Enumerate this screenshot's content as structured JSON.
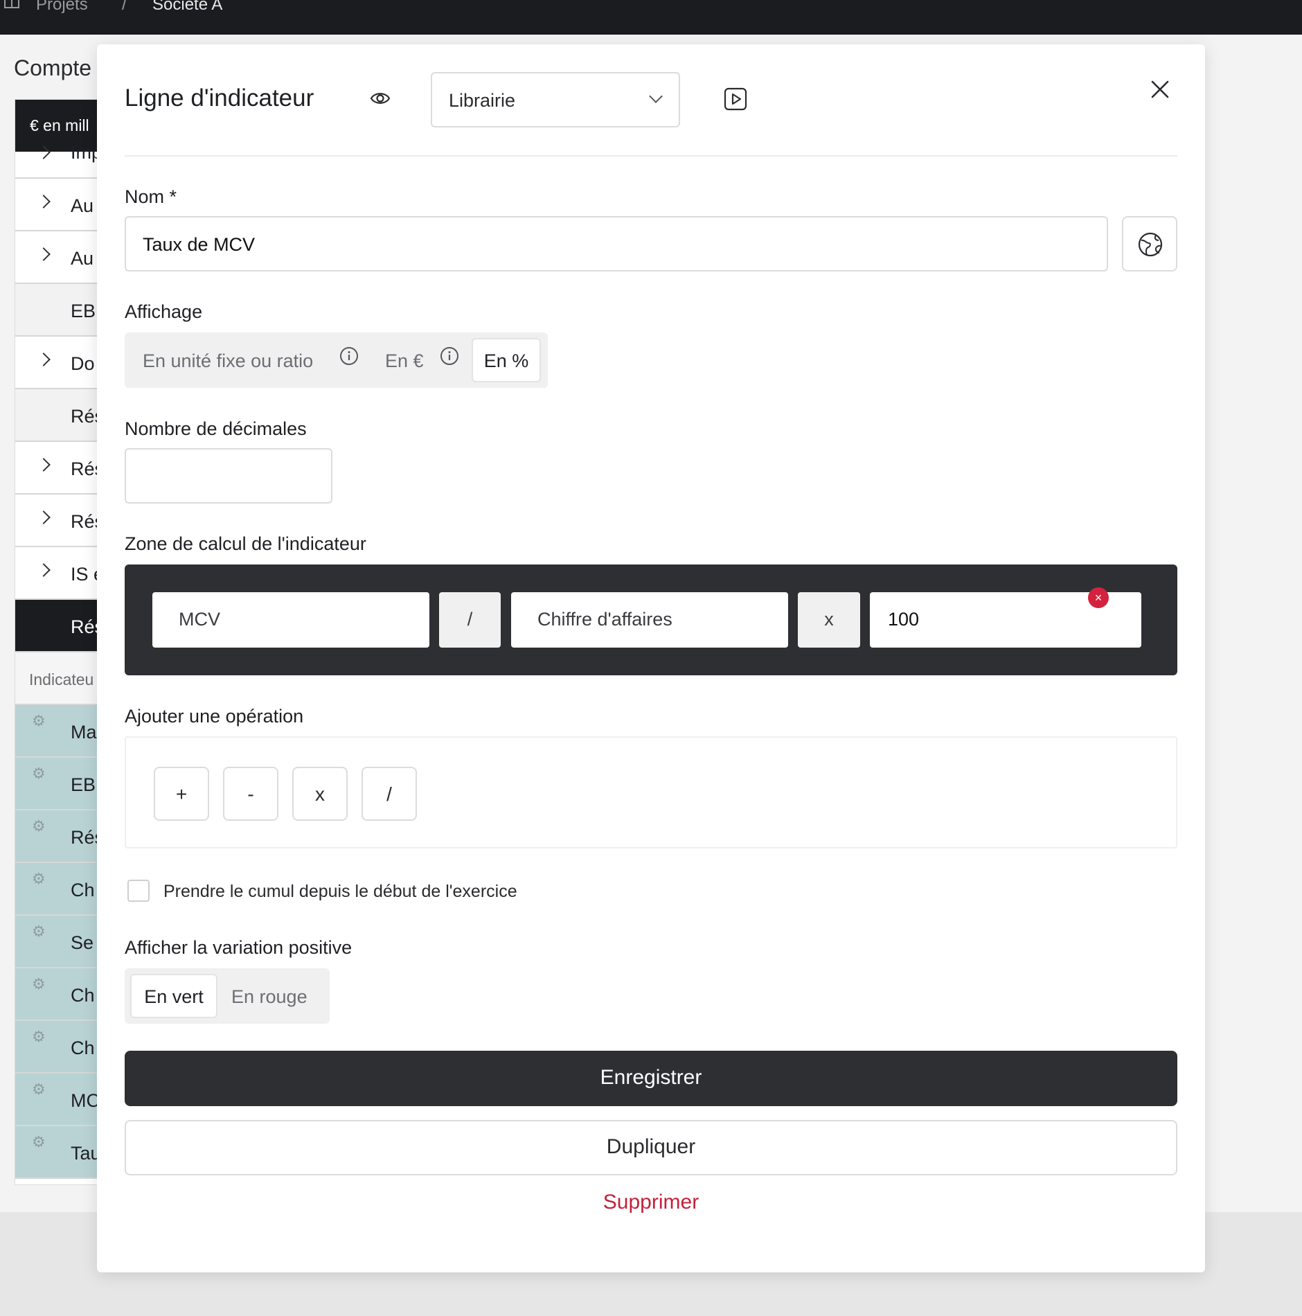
{
  "topbar": {
    "crumb_projects": "Projets",
    "crumb_sep": "/",
    "crumb_company": "Société A"
  },
  "background": {
    "page_title": "Compte",
    "table_header": "€ en mill",
    "rows": [
      {
        "label": "Imp",
        "chevron": true,
        "style": "plain"
      },
      {
        "label": "Au",
        "chevron": true,
        "style": "plain"
      },
      {
        "label": "Au",
        "chevron": true,
        "style": "plain"
      },
      {
        "label": "EB",
        "chevron": false,
        "style": "grey"
      },
      {
        "label": "Do",
        "chevron": true,
        "style": "plain"
      },
      {
        "label": "Rés",
        "chevron": false,
        "style": "grey"
      },
      {
        "label": "Rés",
        "chevron": true,
        "style": "plain"
      },
      {
        "label": "Rés",
        "chevron": true,
        "style": "plain"
      },
      {
        "label": "IS e",
        "chevron": true,
        "style": "plain"
      },
      {
        "label": "Rés",
        "chevron": false,
        "style": "dark"
      }
    ],
    "indicators_header": "Indicateu",
    "indicator_rows": [
      "Ma",
      "EB",
      "Rés",
      "Ch",
      "Se",
      "Ch",
      "Ch",
      "MC",
      "Tau"
    ]
  },
  "modal": {
    "title": "Ligne d'indicateur",
    "library_select": "Librairie",
    "name_label": "Nom *",
    "name_value": "Taux de MCV",
    "display_label": "Affichage",
    "display_options": [
      "En unité fixe ou ratio",
      "En €",
      "En %"
    ],
    "display_selected": "En %",
    "decimals_label": "Nombre de décimales",
    "decimals_value": "",
    "calc_label": "Zone de calcul de l'indicateur",
    "calc_tokens": {
      "operand1": "MCV",
      "op1": "/",
      "operand2": "Chiffre d'affaires",
      "op2": "x",
      "operand3": "100"
    },
    "remove_badge": "×",
    "add_op_label": "Ajouter une opération",
    "operations": [
      "+",
      "-",
      "x",
      "/"
    ],
    "cumul_label": "Prendre le cumul depuis le début de l'exercice",
    "cumul_checked": false,
    "variation_label": "Afficher la variation positive",
    "variation_options": [
      "En vert",
      "En rouge"
    ],
    "variation_selected": "En vert",
    "save_button": "Enregistrer",
    "duplicate_button": "Dupliquer",
    "delete_button": "Supprimer"
  },
  "colors": {
    "dark": "#2e2f33",
    "danger": "#c4213a",
    "teal_row": "#b9d3d4"
  },
  "icons": [
    "eye-icon",
    "chevron-down-icon",
    "play-icon",
    "close-icon",
    "globe-icon",
    "info-icon",
    "gear-icon",
    "chevron-right-icon"
  ]
}
